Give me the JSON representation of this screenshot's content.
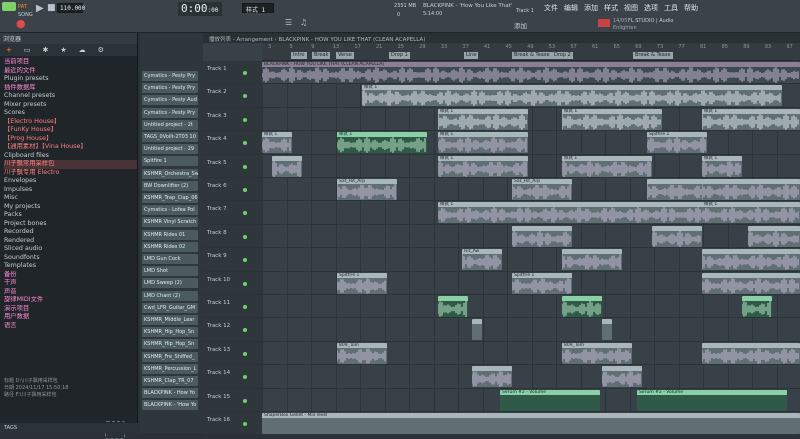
{
  "toolbar": {
    "pat_label": "PAT",
    "song_label": "SONG",
    "tempo": "110.000",
    "time": "0:00",
    "time_small": ":00",
    "pattern_name": "样式 1",
    "cpu": "2351 MB",
    "cpu_sub": "0",
    "project_title": "BLACKPINK - 'How You Like That'",
    "project_time": "5:14:00",
    "track_hint": "Track 1",
    "add_label": "添加",
    "studio_line1": "FL STUDIO | Audio",
    "studio_line2": "Enlighten",
    "studio_num": "14/05",
    "icons": {
      "record": "record-icon",
      "stop": "stop-icon",
      "play": "play-icon",
      "mixer": "mixer-icon",
      "piano": "piano-roll-icon"
    }
  },
  "menu": [
    "文件",
    "编辑",
    "添加",
    "样式",
    "视图",
    "选项",
    "工具",
    "帮助"
  ],
  "browser": {
    "title": "浏览器",
    "items": [
      {
        "label": "当前项目",
        "cls": "pink"
      },
      {
        "label": "最近的文件",
        "cls": "pink"
      },
      {
        "label": "Plugin presets",
        "cls": ""
      },
      {
        "label": "插件数据库",
        "cls": "pink"
      },
      {
        "label": "Channel presets",
        "cls": ""
      },
      {
        "label": "Mixer presets",
        "cls": ""
      },
      {
        "label": "Scores",
        "cls": ""
      },
      {
        "label": "【Electro House】",
        "cls": "hl"
      },
      {
        "label": "【FunKy House】",
        "cls": "hl"
      },
      {
        "label": "【Prog House】",
        "cls": "hl"
      },
      {
        "label": "【通用素材】【Vina House】",
        "cls": "hl"
      },
      {
        "label": "Clipboard files",
        "cls": ""
      },
      {
        "label": "川子飘常用采样包",
        "cls": "sel hl"
      },
      {
        "label": "川子飘专用 Electro",
        "cls": "hl"
      },
      {
        "label": "Envelopes",
        "cls": ""
      },
      {
        "label": "Impulses",
        "cls": ""
      },
      {
        "label": "Misc",
        "cls": ""
      },
      {
        "label": "My projects",
        "cls": ""
      },
      {
        "label": "Packs",
        "cls": ""
      },
      {
        "label": "Project bones",
        "cls": ""
      },
      {
        "label": "Recorded",
        "cls": ""
      },
      {
        "label": "Rendered",
        "cls": ""
      },
      {
        "label": "Sliced audio",
        "cls": ""
      },
      {
        "label": "Soundfonts",
        "cls": ""
      },
      {
        "label": "Templates",
        "cls": ""
      },
      {
        "label": "备份",
        "cls": "pink"
      },
      {
        "label": "干声",
        "cls": "pink"
      },
      {
        "label": "声音",
        "cls": "pink"
      },
      {
        "label": "旋律MIDI文件",
        "cls": "pink"
      },
      {
        "label": "演示项目",
        "cls": "pink"
      },
      {
        "label": "用户数据",
        "cls": "pink"
      },
      {
        "label": "语言",
        "cls": "pink"
      }
    ],
    "info_lines": [
      "标题    D:\\川子飘用采样包",
      "日期    2024/11/17 15:50:18",
      "路径    F:\\川子飘用采样包"
    ],
    "status": "TAGS"
  },
  "picker": [
    "Cymatics - Pesty Pry",
    "Cymatics - Pesty Pry",
    "Cymatics - Pesty Aud",
    "Cymatics - Pesty Pry",
    "Untitled project - 2t",
    "TAGS_0Voilt-2T03 10",
    "Untitled project - 29",
    "Spitfire 1",
    "KSHMR_Orchestra_Sw",
    "BW Downlifter (2)",
    "KSHMR_Trap_Clap_06",
    "Cymatics - Lofea Pol",
    "KSHMR Vinyl Scratch",
    "KSHMR Rides 01",
    "KSHMR Rides 02",
    "LMD Gun Cock",
    "LMD Shot",
    "LMD Sweep (2)",
    "LMD Chant (2)",
    "Cwd_LFR_Guitar_GM",
    "KSHMR_Middle_Lear",
    "KSHMR_Hip_Hop_Sn",
    "KSHMR_Hip_Hop_Sn",
    "KSHMR_Fre_Shiffed_",
    "KSHMR_Percussion_L",
    "KSHMR_Clap_TR_07",
    "BLACKPINK - How Yo",
    "BLACKPINK - 'How Yo"
  ],
  "playlist": {
    "header": "播放列表 - Arrangement › BLACKPINK - HOW YOU LIKE THAT (CLEAN ACAPELLA)",
    "markers": [
      "Intro",
      "Break",
      "Verse",
      "Drop 1",
      "Line",
      "Break & Tease",
      "Drop 2",
      "Break & Tease"
    ],
    "bar_numbers": [
      "3",
      "5",
      "9",
      "13",
      "17",
      "21",
      "25",
      "29",
      "33",
      "37",
      "41",
      "45",
      "49",
      "53",
      "57",
      "61",
      "65",
      "69",
      "73",
      "77",
      "81",
      "85",
      "89",
      "93",
      "97"
    ],
    "tracks": [
      "Track 1",
      "Track 2",
      "Track 3",
      "Track 4",
      "Track 5",
      "Track 6",
      "Track 7",
      "Track 8",
      "Track 9",
      "Track 10",
      "Track 11",
      "Track 12",
      "Track 13",
      "Track 14",
      "Track 15",
      "Track 16"
    ],
    "clip_main": "BLACKPINK - HOW YOU LIKE THAT (CLEAN ACAPELLA)",
    "clip_pattern": "样式 1",
    "clip_spitfire": "Spitfire 1",
    "clip_serum": "Serum #2 - Volume",
    "clip_shaperbox": "ShaperBox Gellet - Mix level",
    "clip_misc": [
      "Sat_Hit_Arp",
      "Hit_Aw",
      "809_Tom"
    ]
  },
  "colors": {
    "accent": "#ff8a2a",
    "brand_green": "#7fd26a",
    "clip_green": "#8ad0a6"
  }
}
